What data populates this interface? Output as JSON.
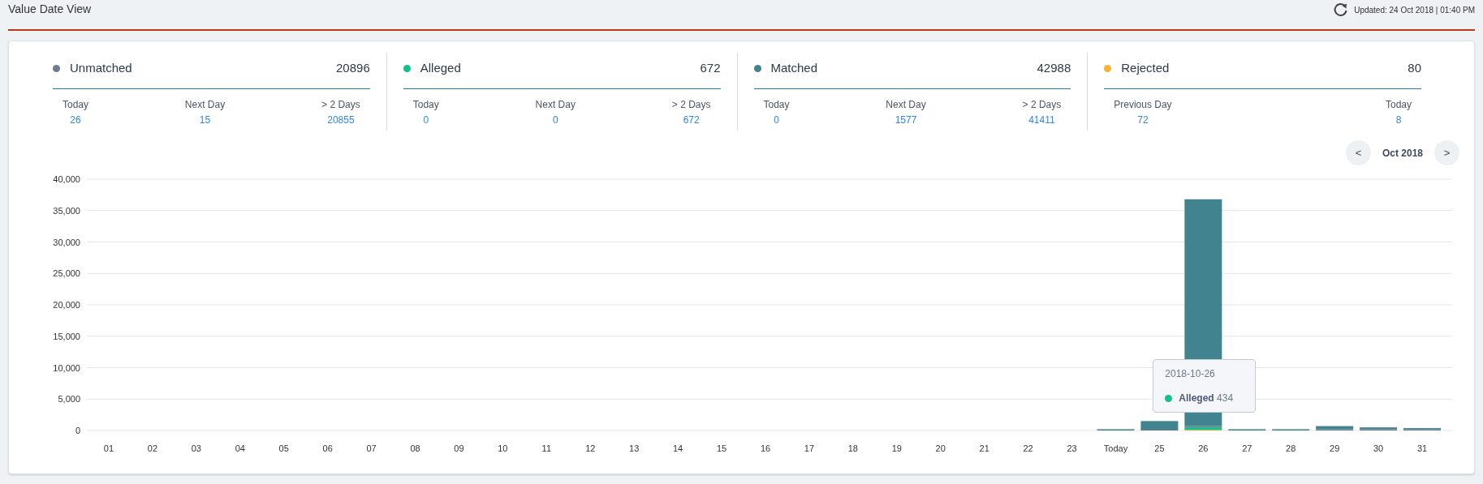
{
  "header": {
    "title": "Value Date View",
    "updated": "Updated: 24 Oct 2018 | 01:40 PM"
  },
  "stats": [
    {
      "label": "Unmatched",
      "color": "#6e7b90",
      "total": "20896",
      "breakdown": [
        {
          "label": "Today",
          "value": "26"
        },
        {
          "label": "Next Day",
          "value": "15"
        },
        {
          "label": "> 2 Days",
          "value": "20855"
        }
      ]
    },
    {
      "label": "Alleged",
      "color": "#12c28b",
      "total": "672",
      "breakdown": [
        {
          "label": "Today",
          "value": "0"
        },
        {
          "label": "Next Day",
          "value": "0"
        },
        {
          "label": "> 2 Days",
          "value": "672"
        }
      ]
    },
    {
      "label": "Matched",
      "color": "#41838f",
      "total": "42988",
      "breakdown": [
        {
          "label": "Today",
          "value": "0"
        },
        {
          "label": "Next Day",
          "value": "1577"
        },
        {
          "label": "> 2 Days",
          "value": "41411"
        }
      ]
    },
    {
      "label": "Rejected",
      "color": "#f5b335",
      "total": "80",
      "breakdown": [
        {
          "label": "Previous Day",
          "value": "72"
        },
        {
          "label": "Today",
          "value": "8"
        }
      ]
    }
  ],
  "month_nav": {
    "prev": "<",
    "label": "Oct 2018",
    "next": ">"
  },
  "chart": {
    "tooltip": {
      "date": "2018-10-26",
      "series": "Alleged",
      "value": "434",
      "color": "#12c28b"
    },
    "chart_data": {
      "type": "bar",
      "stacked": true,
      "grid": true,
      "categories": [
        "01",
        "02",
        "03",
        "04",
        "05",
        "06",
        "07",
        "08",
        "09",
        "10",
        "11",
        "12",
        "13",
        "14",
        "15",
        "16",
        "17",
        "18",
        "19",
        "20",
        "21",
        "22",
        "23",
        "Today",
        "25",
        "26",
        "27",
        "28",
        "29",
        "30",
        "31"
      ],
      "series": [
        {
          "color": "#f5b335",
          "values": [
            0,
            0,
            0,
            0,
            0,
            0,
            0,
            0,
            0,
            0,
            0,
            0,
            0,
            0,
            0,
            0,
            0,
            0,
            0,
            0,
            0,
            0,
            0,
            0,
            0,
            100,
            0,
            0,
            0,
            0,
            0
          ]
        },
        {
          "color": "#12c28b",
          "values": [
            0,
            0,
            0,
            0,
            0,
            0,
            0,
            0,
            0,
            0,
            0,
            0,
            0,
            0,
            0,
            0,
            0,
            0,
            0,
            0,
            0,
            0,
            0,
            0,
            0,
            400,
            0,
            0,
            0,
            0,
            0
          ]
        },
        {
          "color": "#6e7b90",
          "values": [
            0,
            0,
            0,
            0,
            0,
            0,
            0,
            0,
            0,
            0,
            0,
            0,
            0,
            0,
            0,
            0,
            0,
            0,
            0,
            0,
            0,
            0,
            0,
            0,
            100,
            200,
            0,
            0,
            200,
            200,
            200
          ]
        },
        {
          "color": "#41838f",
          "values": [
            0,
            0,
            0,
            0,
            0,
            0,
            0,
            0,
            0,
            0,
            0,
            0,
            0,
            0,
            0,
            0,
            0,
            0,
            0,
            0,
            0,
            0,
            0,
            200,
            1400,
            36100,
            200,
            200,
            500,
            300,
            100
          ]
        }
      ],
      "ylim": [
        0,
        40000
      ],
      "yticks": [
        {
          "value": 0,
          "label": "0"
        },
        {
          "value": 5000,
          "label": "5,000"
        },
        {
          "value": 10000,
          "label": "10,000"
        },
        {
          "value": 15000,
          "label": "15,000"
        },
        {
          "value": 20000,
          "label": "20,000"
        },
        {
          "value": 25000,
          "label": "25,000"
        },
        {
          "value": 30000,
          "label": "30,000"
        },
        {
          "value": 35000,
          "label": "35,000"
        },
        {
          "value": 40000,
          "label": "40,000"
        }
      ]
    }
  }
}
